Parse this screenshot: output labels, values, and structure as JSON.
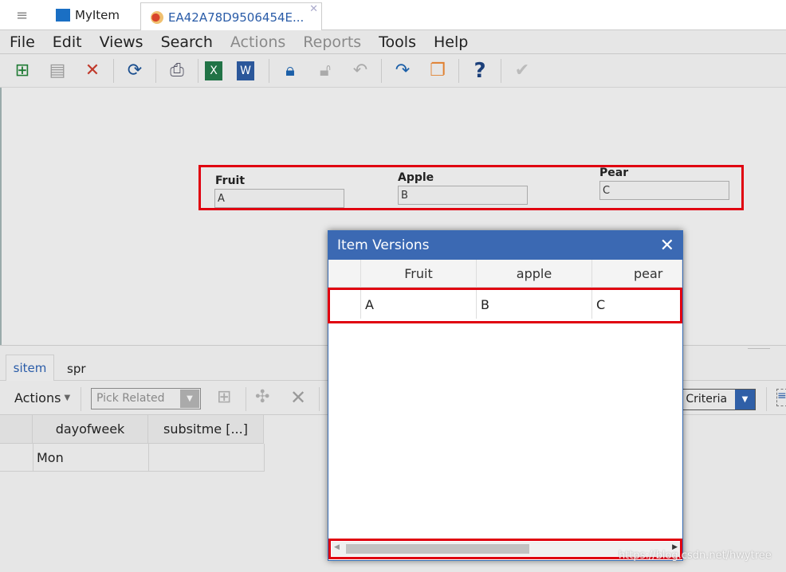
{
  "tabs": [
    {
      "label": "MyItem",
      "icon": "item-icon"
    },
    {
      "label": "EA42A78D9506454E...",
      "icon": "item-instance-icon",
      "active": true
    }
  ],
  "menu": [
    {
      "label": "File",
      "enabled": true
    },
    {
      "label": "Edit",
      "enabled": true
    },
    {
      "label": "Views",
      "enabled": true
    },
    {
      "label": "Search",
      "enabled": true
    },
    {
      "label": "Actions",
      "enabled": false
    },
    {
      "label": "Reports",
      "enabled": false
    },
    {
      "label": "Tools",
      "enabled": true
    },
    {
      "label": "Help",
      "enabled": true
    }
  ],
  "toolbar": [
    "new-icon",
    "save-icon",
    "delete-icon",
    "refresh-icon",
    "print-icon",
    "excel-icon",
    "word-icon",
    "lock-icon",
    "unlock-icon",
    "undo-icon",
    "promote-icon",
    "version-icon",
    "help-icon",
    "done-icon"
  ],
  "form": {
    "fields": [
      {
        "label": "Fruit",
        "value": "A"
      },
      {
        "label": "Apple",
        "value": "B"
      },
      {
        "label": "Pear",
        "value": "C"
      }
    ]
  },
  "dialog": {
    "title": "Item Versions",
    "columns": [
      "Fruit",
      "apple",
      "pear"
    ],
    "rows": [
      [
        "A",
        "B",
        "C"
      ]
    ]
  },
  "relationships": {
    "tabs": [
      "sitem",
      "spr"
    ],
    "actions_label": "Actions",
    "pick_related": "Pick Related",
    "search_criteria": "h Criteria",
    "columns": [
      "dayofweek",
      "subsitme [...]"
    ],
    "rows": [
      [
        "Mon",
        ""
      ]
    ]
  },
  "watermark": "https://blog.csdn.net/hwytree",
  "colors": {
    "accent": "#3b69b3",
    "highlight": "#e00010"
  }
}
